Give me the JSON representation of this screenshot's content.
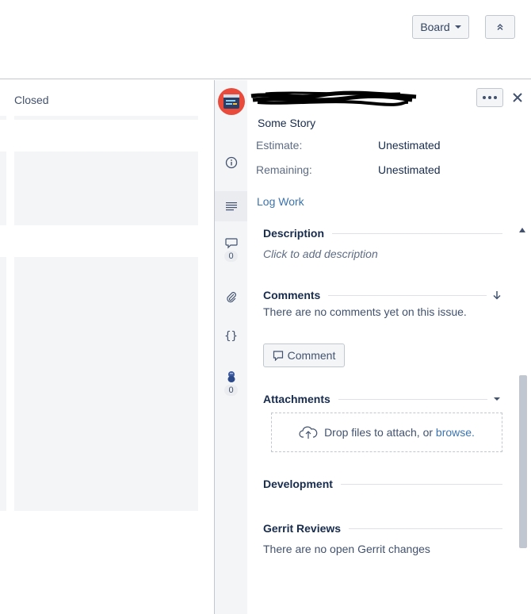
{
  "toolbar": {
    "board_label": "Board",
    "board_icon": "chevron-down-icon",
    "collapse_icon": "double-chevron-up-icon"
  },
  "board": {
    "column_title": "Closed"
  },
  "issue": {
    "avatar_icon": "story-avatar-icon",
    "title": "Some Story",
    "fields": [
      {
        "label": "Estimate:",
        "value": "Unestimated"
      },
      {
        "label": "Remaining:",
        "value": "Unestimated"
      }
    ],
    "log_work": "Log Work",
    "more_icon": "more-dots-icon",
    "close_icon": "close-icon"
  },
  "rail": {
    "comments_count": "0",
    "chat_count": "0"
  },
  "sections": {
    "description": {
      "title": "Description",
      "placeholder": "Click to add description"
    },
    "comments": {
      "title": "Comments",
      "empty": "There are no comments yet on this issue.",
      "button": "Comment"
    },
    "attachments": {
      "title": "Attachments",
      "drop_text": "Drop files to attach, or",
      "browse": "browse."
    },
    "development": {
      "title": "Development"
    },
    "gerrit": {
      "title": "Gerrit Reviews",
      "empty": "There are no open Gerrit changes"
    }
  },
  "colors": {
    "link": "#3b73af",
    "avatar": "#e84a3c"
  }
}
